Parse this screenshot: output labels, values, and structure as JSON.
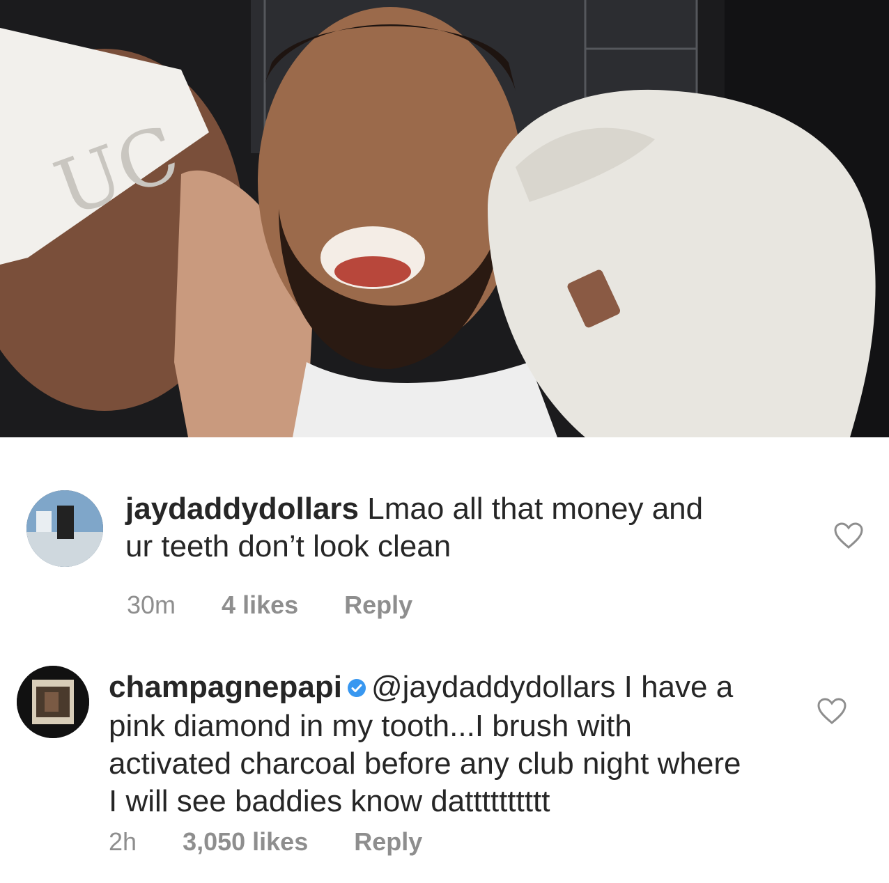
{
  "post": {
    "image_icon": "photo-image"
  },
  "comments": [
    {
      "username": "jaydaddydollars",
      "verified": false,
      "text_line1": "Lmao all that money and",
      "text_line2": "ur teeth don’t look clean",
      "time": "30m",
      "likes": "4 likes",
      "reply": "Reply",
      "like_icon": "heart-outline-icon"
    },
    {
      "username": "champagnepapi",
      "verified": true,
      "mention": "@jaydaddydollars",
      "text_line1_rest": "I have a",
      "text_line2": "pink diamond in my tooth...I brush with",
      "text_line3": "activated charcoal before any club night where",
      "text_line4": "I will see baddies know datttttttttt",
      "time": "2h",
      "likes": "3,050 likes",
      "reply": "Reply",
      "like_icon": "heart-outline-icon",
      "verified_icon": "verified-badge-icon",
      "verified_color": "#3897f0"
    }
  ]
}
